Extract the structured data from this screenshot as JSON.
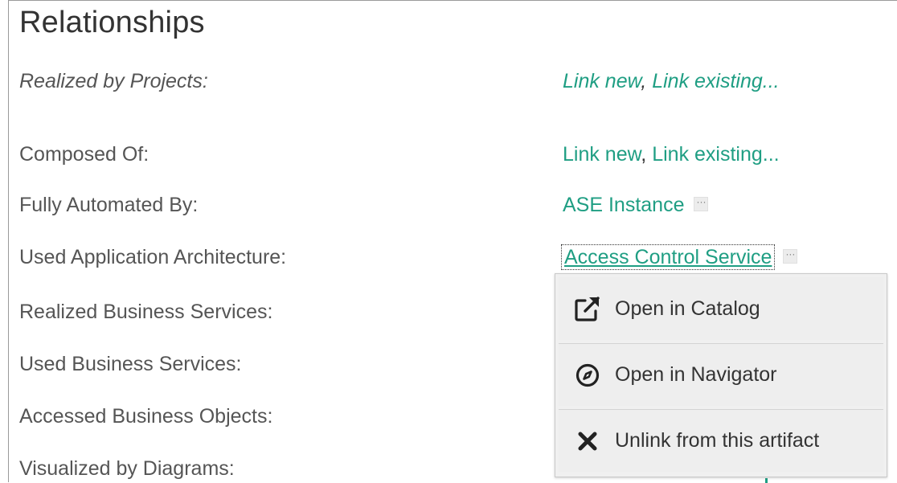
{
  "section": {
    "title": "Relationships"
  },
  "rows": [
    {
      "label": "Realized by Projects:",
      "link_new": "Link new",
      "separator": ",",
      "link_existing": "Link existing..."
    },
    {
      "label": "Composed Of:",
      "link_new": "Link new",
      "separator": ",",
      "link_existing": "Link existing..."
    },
    {
      "label": "Fully Automated By:",
      "value": "ASE Instance"
    },
    {
      "label": "Used Application Architecture:",
      "value": "Access Control Service"
    },
    {
      "label": "Realized Business Services:"
    },
    {
      "label": "Used Business Services:"
    },
    {
      "label": "Accessed Business Objects:"
    },
    {
      "label": "Visualized by Diagrams:"
    }
  ],
  "more_button": {
    "glyph": "···"
  },
  "context_menu": {
    "items": [
      {
        "label": "Open in Catalog",
        "icon": "open-external-icon"
      },
      {
        "label": "Open in Navigator",
        "icon": "compass-icon"
      },
      {
        "label": "Unlink from this artifact",
        "icon": "close-x-icon"
      }
    ]
  },
  "colors": {
    "link": "#1f9e83",
    "label": "#555555",
    "title": "#333333",
    "menu_bg": "#eeeeee"
  }
}
